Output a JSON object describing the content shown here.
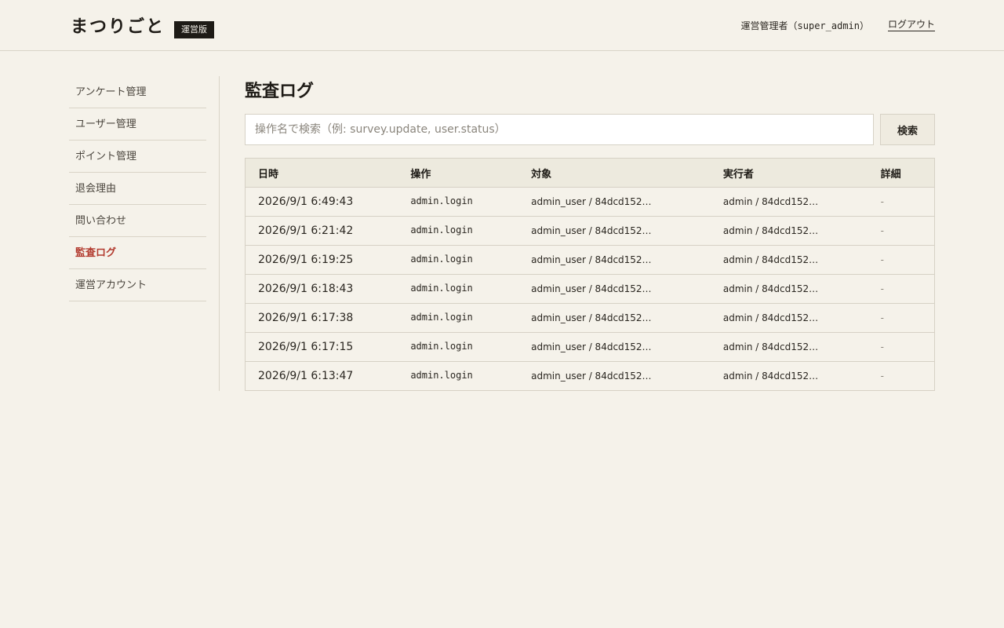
{
  "header": {
    "brand": "まつりごと",
    "badge": "運営版",
    "user_role": "運営管理者",
    "user_id": "（super_admin）",
    "logout_label": "ログアウト"
  },
  "sidebar": {
    "items": [
      {
        "label": "アンケート管理",
        "active": false
      },
      {
        "label": "ユーザー管理",
        "active": false
      },
      {
        "label": "ポイント管理",
        "active": false
      },
      {
        "label": "退会理由",
        "active": false
      },
      {
        "label": "問い合わせ",
        "active": false
      },
      {
        "label": "監査ログ",
        "active": true
      },
      {
        "label": "運営アカウント",
        "active": false
      }
    ]
  },
  "main": {
    "title": "監査ログ",
    "search": {
      "placeholder": "操作名で検索（例: survey.update, user.status）",
      "value": "",
      "button_label": "検索"
    },
    "table": {
      "columns": [
        "日時",
        "操作",
        "対象",
        "実行者",
        "詳細"
      ],
      "rows": [
        {
          "time": "2026/9/1 6:49:43",
          "operation": "admin.login",
          "target": "admin_user / 84dcd152…",
          "actor": "admin / 84dcd152…",
          "detail": "-"
        },
        {
          "time": "2026/9/1 6:21:42",
          "operation": "admin.login",
          "target": "admin_user / 84dcd152…",
          "actor": "admin / 84dcd152…",
          "detail": "-"
        },
        {
          "time": "2026/9/1 6:19:25",
          "operation": "admin.login",
          "target": "admin_user / 84dcd152…",
          "actor": "admin / 84dcd152…",
          "detail": "-"
        },
        {
          "time": "2026/9/1 6:18:43",
          "operation": "admin.login",
          "target": "admin_user / 84dcd152…",
          "actor": "admin / 84dcd152…",
          "detail": "-"
        },
        {
          "time": "2026/9/1 6:17:38",
          "operation": "admin.login",
          "target": "admin_user / 84dcd152…",
          "actor": "admin / 84dcd152…",
          "detail": "-"
        },
        {
          "time": "2026/9/1 6:17:15",
          "operation": "admin.login",
          "target": "admin_user / 84dcd152…",
          "actor": "admin / 84dcd152…",
          "detail": "-"
        },
        {
          "time": "2026/9/1 6:13:47",
          "operation": "admin.login",
          "target": "admin_user / 84dcd152…",
          "actor": "admin / 84dcd152…",
          "detail": "-"
        }
      ]
    }
  },
  "colors": {
    "background": "#f5f2ea",
    "accent": "#b23a2e",
    "ink": "#1e1b16",
    "border": "#d6d1c5"
  }
}
